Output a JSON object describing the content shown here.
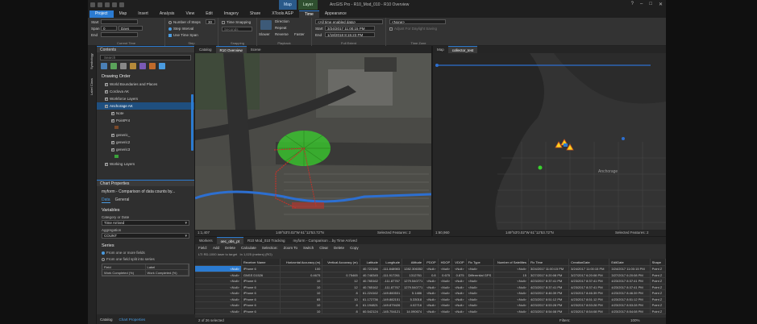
{
  "app": {
    "title": "ArcGIS Pro - R10_Mod_010 - R10 Overview"
  },
  "context_tabs": [
    {
      "group": "Map",
      "tab": "Time"
    },
    {
      "group": "Layer",
      "tab": "Appearance"
    }
  ],
  "ribbon_tabs": [
    "Project",
    "Map",
    "Insert",
    "Analysis",
    "View",
    "Edit",
    "Imagery",
    "Share",
    "XTools AGP",
    "Time",
    "Appearance"
  ],
  "ribbon": {
    "current_time": {
      "start_label": "Start",
      "span_label": "Span",
      "span_value": "0",
      "span_unit": "Days",
      "end_label": "End",
      "group": "Current Time"
    },
    "step": {
      "num_steps": "Number of Steps",
      "num_steps_value": "30",
      "step_interval": "Step Interval",
      "use_time_span": "Use Time Span",
      "group": "Step"
    },
    "snapping": {
      "time_snapping": "Time Snapping",
      "seconds": "Seconds",
      "group": "Snapping"
    },
    "playback": {
      "direction": "Direction",
      "repeat": "Repeat",
      "reverse": "Reverse",
      "slower": "Slower",
      "faster": "Faster",
      "group": "Playback"
    },
    "full_extent": {
      "start_label": "Start",
      "start_value": "3/24/2017 11:00:15 PM",
      "end_label": "End",
      "end_value": "1/18/2018 8:15:23 PM",
      "group": "Full Extent",
      "all_time": "<All time enabled data>"
    },
    "time_zone": {
      "value": "<None>",
      "adjust_dst": "Adjust For Daylight Saving",
      "group": "Time Zone"
    }
  },
  "sidebar_tabs": [
    "Symbology",
    "Label Class"
  ],
  "contents": {
    "title": "Contents",
    "search_placeholder": "Search",
    "drawing_order": "Drawing Order",
    "items": [
      {
        "label": "World Boundaries and Places",
        "indent": 1
      },
      {
        "label": "Cordova AK",
        "indent": 1
      },
      {
        "label": "Workforce Layers",
        "indent": 1
      },
      {
        "label": "Anchorage AK",
        "indent": 1,
        "selected": true
      },
      {
        "label": "Note",
        "indent": 2
      },
      {
        "label": "PointPnt",
        "indent": 2
      },
      {
        "label": "",
        "indent": 2
      },
      {
        "label": "generic_",
        "indent": 2
      },
      {
        "label": "generic2",
        "indent": 2
      },
      {
        "label": "generic3",
        "indent": 2
      },
      {
        "label": "",
        "indent": 2
      },
      {
        "label": "Working Layers",
        "indent": 1
      }
    ]
  },
  "chart_properties": {
    "title": "Chart Properties",
    "chart_name": "myform - Comparison of data counts by...",
    "tabs": [
      "Data",
      "General"
    ],
    "variables": "Variables",
    "category_label": "Category or Date",
    "category_value": "Time Arrived",
    "aggregation_label": "Aggregation",
    "aggregation_value": "COUNT",
    "series": "Series",
    "series_opt1": "From one or more fields",
    "series_opt2": "From one field split into series",
    "table_head": [
      "Field",
      "Label"
    ],
    "table_row": [
      "Work Completed (%)",
      "Work Completed (%)"
    ]
  },
  "bottom_tabs": [
    "Catalog",
    "Chart Properties"
  ],
  "view_left": {
    "tabs": [
      "Catalog",
      "R10 Overview",
      "Scene"
    ],
    "scale": "1:1,407",
    "coords": "149°53'0.02\"W 61°12'53.72\"N",
    "selected": "Selected Features: 2"
  },
  "view_right": {
    "tabs": [
      "Map",
      "collector_test"
    ],
    "scale": "1:60,960",
    "coords": "149°53'0.02\"W 61°12'53.72\"N",
    "selected": "Selected Features: 2",
    "place": "Anchorage"
  },
  "attributes": {
    "tabs": [
      "Workers",
      "oec_obs_pt",
      "R10 Mod_010 Tracking",
      "myform - Comparison ...by Time Arrived"
    ],
    "toolbar": [
      "Field:",
      "Add",
      "Delete",
      "Calculate",
      "Selection:",
      "Zoom To",
      "Switch",
      "Clear",
      "Delete",
      "Copy"
    ],
    "crumb1": "LTI RD-1000 laser to target",
    "crumb2": "In 1,025 (meters) (RO)",
    "columns": [
      "",
      "Receiver Name",
      "Horizontal Accuracy (m)",
      "Vertical Accuracy (m)",
      "Latitude",
      "Longitude",
      "Altitude",
      "PDOP",
      "HDOP",
      "VDOP",
      "Fix Type",
      "Number of Satellites",
      "Fix Time",
      "CreationDate",
      "EditDate",
      "Shape"
    ],
    "rows": [
      [
        "<Null>",
        "iPhone 6",
        "100",
        "",
        "40.722186",
        "-111.848983",
        "1282.306352",
        "<Null>",
        "<Null>",
        "<Null>",
        "<Null>",
        "<Null>",
        "3/24/2017 11:00:15 PM",
        "3/24/2017 11:00:15 PM",
        "3/24/2017 11:00:15 PM",
        "Point Z"
      ],
      [
        "<Null>",
        "GNSS D1526",
        "0.4675",
        "0.75465",
        "40.748345",
        "-111.917261",
        "1312761",
        "0.8",
        "0.675",
        "0.875",
        "Differential GPS",
        "15",
        "3/27/2017 6:20:08 PM",
        "3/27/2017 6:20:08 PM",
        "3/27/2017 6:20:08 PM",
        "Point Z"
      ],
      [
        "<Null>",
        "iPhone 6",
        "10",
        "12",
        "40.765162",
        "-111.87767",
        "1279.540771",
        "<Null>",
        "<Null>",
        "<Null>",
        "<Null>",
        "<Null>",
        "4/23/2017 8:37:41 PM",
        "4/23/2017 8:37:41 PM",
        "4/23/2017 8:37:41 PM",
        "Point Z"
      ],
      [
        "<Null>",
        "iPhone 6",
        "10",
        "12",
        "40.765162",
        "-111.87767",
        "1279.540771",
        "<Null>",
        "<Null>",
        "<Null>",
        "<Null>",
        "<Null>",
        "4/23/2017 8:37:41 PM",
        "4/23/2017 8:37:41 PM",
        "4/23/2017 8:37:41 PM",
        "Point Z"
      ],
      [
        "<Null>",
        "iPhone 6",
        "10",
        "8",
        "61.224162",
        "-149.860531",
        "5.1486",
        "<Null>",
        "<Null>",
        "<Null>",
        "<Null>",
        "<Null>",
        "4/23/2017 8:46:39 PM",
        "4/23/2017 8:46:39 PM",
        "4/23/2017 8:46:39 PM",
        "Point Z"
      ],
      [
        "<Null>",
        "iPhone 6",
        "65",
        "10",
        "61.172736",
        "-149.882151",
        "5.33018",
        "<Null>",
        "<Null>",
        "<Null>",
        "<Null>",
        "<Null>",
        "4/23/2017 8:51:12 PM",
        "4/23/2017 8:51:12 PM",
        "4/23/2017 8:51:12 PM",
        "Point Z"
      ],
      [
        "<Null>",
        "iPhone 6",
        "10",
        "8",
        "61.194821",
        "-149.879426",
        "4.02716",
        "<Null>",
        "<Null>",
        "<Null>",
        "<Null>",
        "<Null>",
        "4/23/2017 8:53:28 PM",
        "4/23/2017 8:53:28 PM",
        "4/23/2017 8:53:28 PM",
        "Point Z"
      ],
      [
        "<Null>",
        "iPhone 6",
        "10",
        "8",
        "60.542124",
        "-145.754121",
        "14.090674",
        "<Null>",
        "<Null>",
        "<Null>",
        "<Null>",
        "<Null>",
        "4/23/2017 8:54:08 PM",
        "4/23/2017 8:54:08 PM",
        "4/23/2017 8:54:08 PM",
        "Point Z"
      ]
    ],
    "status": "2 of 26 selected",
    "filters": "Filters:",
    "zoom": "100%"
  },
  "colors": {
    "accent": "#2b7bd1",
    "buffer": "#39d12e",
    "marker": "#ffd21f"
  }
}
